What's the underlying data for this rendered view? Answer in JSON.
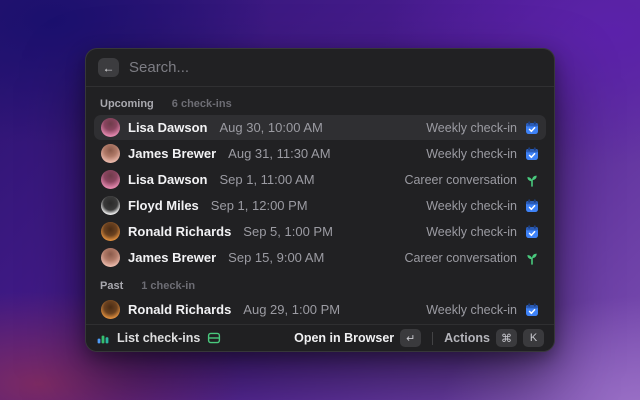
{
  "window": {
    "search": {
      "placeholder": "Search...",
      "back_glyph": "←"
    },
    "sections": [
      {
        "label": "Upcoming",
        "count": "6 check-ins",
        "items": [
          {
            "name": "Lisa Dawson",
            "datetime": "Aug 30, 10:00 AM",
            "kind": "Weekly check-in",
            "icon": "calendar-check",
            "selected": true
          },
          {
            "name": "James Brewer",
            "datetime": "Aug 31, 11:30 AM",
            "kind": "Weekly check-in",
            "icon": "calendar-check",
            "selected": false
          },
          {
            "name": "Lisa Dawson",
            "datetime": "Sep 1, 11:00 AM",
            "kind": "Career conversation",
            "icon": "sprout",
            "selected": false
          },
          {
            "name": "Floyd Miles",
            "datetime": "Sep 1, 12:00 PM",
            "kind": "Weekly check-in",
            "icon": "calendar-check",
            "selected": false
          },
          {
            "name": "Ronald Richards",
            "datetime": "Sep 5, 1:00 PM",
            "kind": "Weekly check-in",
            "icon": "calendar-check",
            "selected": false
          },
          {
            "name": "James Brewer",
            "datetime": "Sep 15, 9:00 AM",
            "kind": "Career conversation",
            "icon": "sprout",
            "selected": false
          }
        ]
      },
      {
        "label": "Past",
        "count": "1 check-in",
        "items": [
          {
            "name": "Ronald Richards",
            "datetime": "Aug 29, 1:00 PM",
            "kind": "Weekly check-in",
            "icon": "calendar-check",
            "selected": false
          }
        ]
      }
    ],
    "footer": {
      "command_label": "List check-ins",
      "open_label": "Open in Browser",
      "open_key": "↵",
      "actions_label": "Actions",
      "actions_key_1": "⌘",
      "actions_key_2": "K"
    },
    "colors": {
      "weekly_icon_blue": "#3e82f7",
      "career_icon_green": "#49c97d",
      "window_bg": "#212123",
      "selected_row": "#2f2f32"
    }
  }
}
